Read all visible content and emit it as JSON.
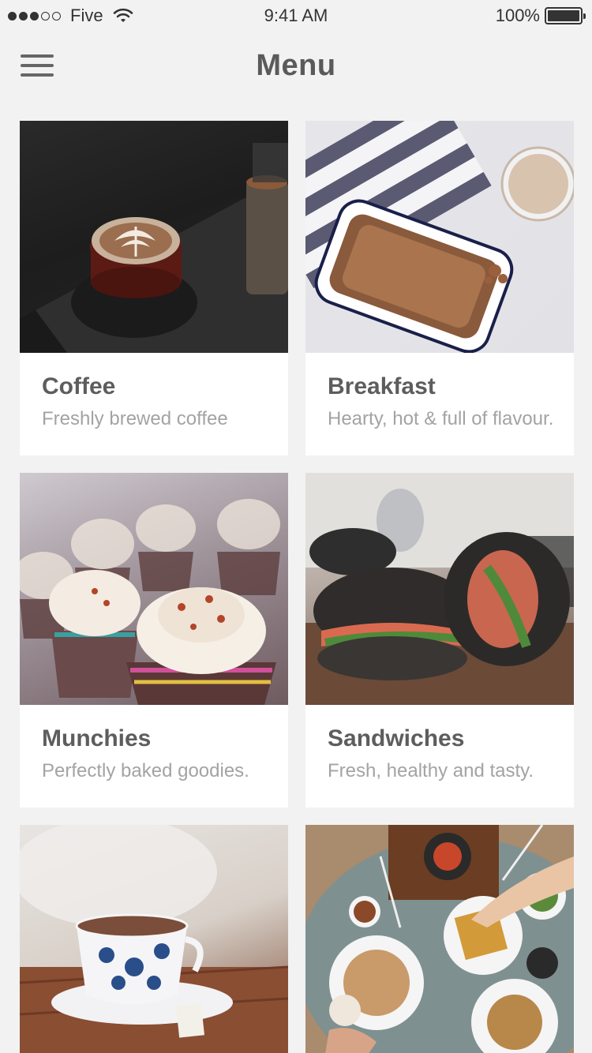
{
  "status_bar": {
    "carrier": "Five",
    "time": "9:41 AM",
    "battery": "100%",
    "signal_bars_filled": 3,
    "signal_bars_total": 5
  },
  "header": {
    "title": "Menu",
    "menu_icon": "hamburger-icon"
  },
  "categories": [
    {
      "title": "Coffee",
      "description": "Freshly brewed coffee",
      "image": "latte-art-cup"
    },
    {
      "title": "Breakfast",
      "description": "Hearty, hot & full of flavour.",
      "image": "granola-dish"
    },
    {
      "title": "Munchies",
      "description": "Perfectly baked goodies.",
      "image": "cupcakes"
    },
    {
      "title": "Sandwiches",
      "description": "Fresh, healthy and tasty.",
      "image": "salmon-sandwich"
    },
    {
      "title": "",
      "description": "",
      "image": "tea-cup"
    },
    {
      "title": "",
      "description": "",
      "image": "brunch-table"
    }
  ]
}
